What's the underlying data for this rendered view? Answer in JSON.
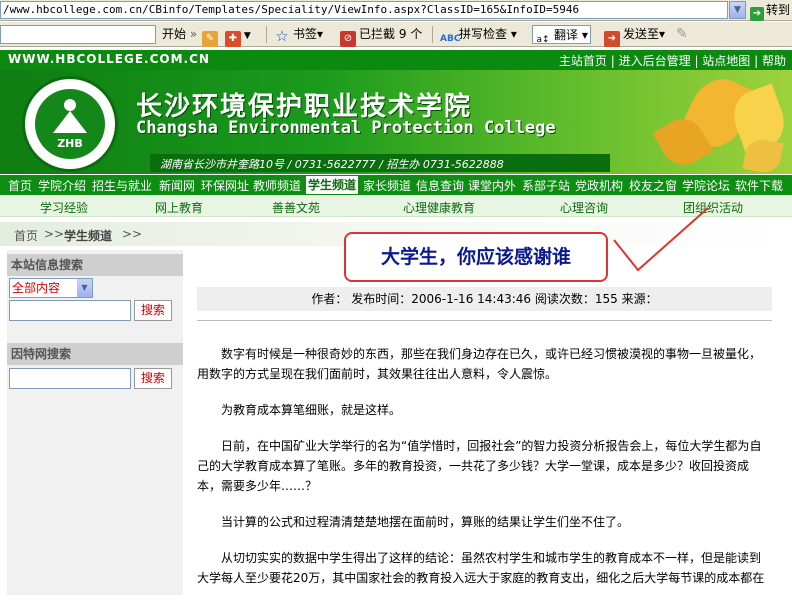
{
  "browser": {
    "address_url": "/www.hbcollege.com.cn/CBinfo/Templates/Speciality/ViewInfo.aspx?ClassID=165&InfoID=5946",
    "go_label": "转到"
  },
  "toolbar": {
    "start_label": "开始",
    "bookmarks_label": "书签▾",
    "blocked_label": "已拦截 9 个",
    "spellcheck_label": "拼写检查 ▾",
    "translate_label": "翻译 ▾",
    "sendto_label": "发送至▾"
  },
  "site": {
    "url_text": "WWW.HBCOLLEGE.COM.CN",
    "top_links": [
      "主站首页",
      "进入后台管理",
      "站点地图",
      "帮助"
    ],
    "logo_text": "ZHB",
    "college_cn": "长沙环境保护职业技术学院",
    "college_en": "Changsha Environmental Protection College",
    "address": "湖南省长沙市井奎路10号 / 0731-5622777 / 招生办 0731-5622888"
  },
  "nav": {
    "items": [
      "首页",
      "学院介绍",
      "招生与就业",
      "新闻网",
      "环保网址",
      "教师频道",
      "学生频道",
      "家长频道",
      "信息查询",
      "课堂内外",
      "系部子站",
      "党政机构",
      "校友之窗",
      "学院论坛",
      "软件下载"
    ],
    "active": "学生频道"
  },
  "subnav": {
    "items": [
      "学习经验",
      "网上教育",
      "善善文苑",
      "心理健康教育",
      "心理咨询",
      "团组织活动"
    ]
  },
  "breadcrumb": {
    "home": "首页",
    "sep": ">>",
    "current": "学生频道",
    "end": ">>"
  },
  "sidebar": {
    "site_search_title": "本站信息搜索",
    "select_value": "全部内容",
    "search_button": "搜索",
    "web_search_title": "因特网搜索",
    "web_search_button": "搜索"
  },
  "article": {
    "title": "大学生，你应该感谢谁",
    "meta": "作者： 发布时间：2006-1-16 14:43:46 阅读次数：155 来源：",
    "paragraphs": [
      "数字有时候是一种很奇妙的东西，那些在我们身边存在已久，或许已经习惯被漠视的事物一旦被量化，用数字的方式呈现在我们面前时，其效果往往出人意料，令人震惊。",
      "为教育成本算笔细账，就是这样。",
      "日前，在中国矿业大学举行的名为“值学惜时，回报社会”的智力投资分析报告会上，每位大学生都为自己的大学教育成本算了笔账。多年的教育投资，一共花了多少钱？大学一堂课，成本是多少？收回投资成本，需要多少年……？",
      "当计算的公式和过程清清楚楚地摆在面前时，算账的结果让学生们坐不住了。",
      "从切切实实的数据中学生得出了这样的结论：虽然农村学生和城市学生的教育成本不一样，但是能读到大学每人至少要花20万，其中国家社会的教育投入远大于家庭的教育支出，细化之后大学每节课的成本都在"
    ]
  },
  "colors": {
    "site_green": "#0b8a0f",
    "callout_red": "#d33333",
    "title_blue": "#0a1a8c"
  }
}
